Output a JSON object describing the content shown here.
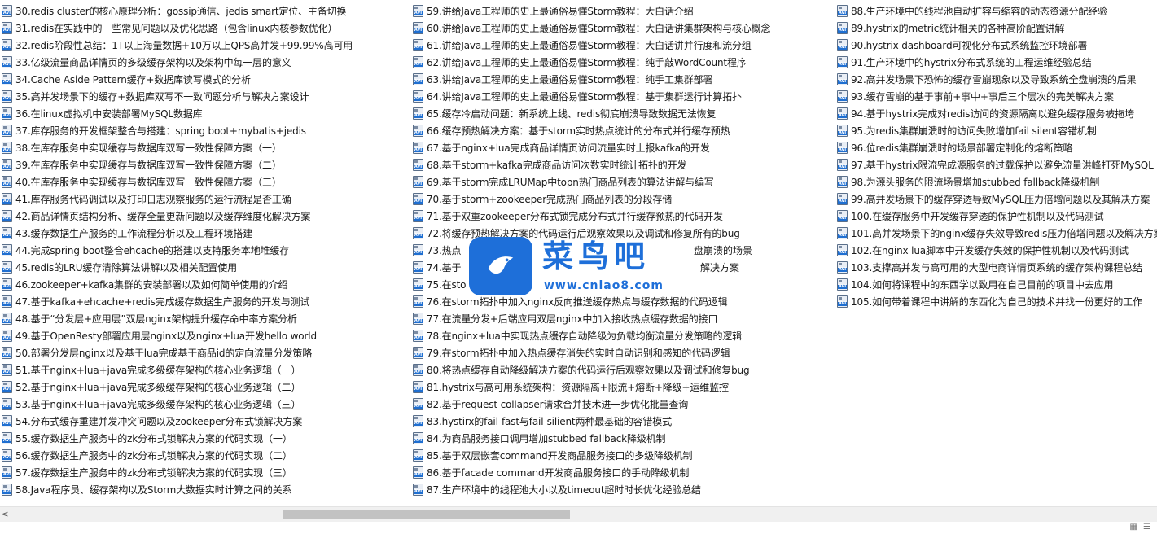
{
  "files": {
    "column1": [
      "30.redis cluster的核心原理分析：gossip通信、jedis smart定位、主备切换",
      "31.redis在实践中的一些常见问题以及优化思路（包含linux内核参数优化）",
      "32.redis阶段性总结：1T以上海量数据+10万以上QPS高并发+99.99%高可用",
      "33.亿级流量商品详情页的多级缓存架构以及架构中每一层的意义",
      "34.Cache Aside Pattern缓存+数据库读写模式的分析",
      "35.高并发场景下的缓存+数据库双写不一致问题分析与解决方案设计",
      "36.在linux虚拟机中安装部署MySQL数据库",
      "37.库存服务的开发框架整合与搭建：spring boot+mybatis+jedis",
      "38.在库存服务中实现缓存与数据库双写一致性保障方案（一）",
      "39.在库存服务中实现缓存与数据库双写一致性保障方案（二）",
      "40.在库存服务中实现缓存与数据库双写一致性保障方案（三）",
      "41.库存服务代码调试以及打印日志观察服务的运行流程是否正确",
      "42.商品详情页结构分析、缓存全量更新问题以及缓存维度化解决方案",
      "43.缓存数据生产服务的工作流程分析以及工程环境搭建",
      "44.完成spring boot整合ehcache的搭建以支持服务本地堆缓存",
      "45.redis的LRU缓存清除算法讲解以及相关配置使用",
      "46.zookeeper+kafka集群的安装部署以及如何简单使用的介绍",
      "47.基于kafka+ehcache+redis完成缓存数据生产服务的开发与测试",
      "48.基于“分发层+应用层”双层nginx架构提升缓存命中率方案分析",
      "49.基于OpenResty部署应用层nginx以及nginx+lua开发hello world",
      "50.部署分发层nginx以及基于lua完成基于商品id的定向流量分发策略",
      "51.基于nginx+lua+java完成多级缓存架构的核心业务逻辑（一）",
      "52.基于nginx+lua+java完成多级缓存架构的核心业务逻辑（二）",
      "53.基于nginx+lua+java完成多级缓存架构的核心业务逻辑（三）",
      "54.分布式缓存重建并发冲突问题以及zookeeper分布式锁解决方案",
      "55.缓存数据生产服务中的zk分布式锁解决方案的代码实现（一）",
      "56.缓存数据生产服务中的zk分布式锁解决方案的代码实现（二）",
      "57.缓存数据生产服务中的zk分布式锁解决方案的代码实现（三）",
      "58.Java程序员、缓存架构以及Storm大数据实时计算之间的关系"
    ],
    "column2": [
      "59.讲给Java工程师的史上最通俗易懂Storm教程：大白话介绍",
      "60.讲给Java工程师的史上最通俗易懂Storm教程：大白话讲集群架构与核心概念",
      "61.讲给Java工程师的史上最通俗易懂Storm教程：大白话讲并行度和流分组",
      "62.讲给Java工程师的史上最通俗易懂Storm教程：纯手敲WordCount程序",
      "63.讲给Java工程师的史上最通俗易懂Storm教程：纯手工集群部署",
      "64.讲给Java工程师的史上最通俗易懂Storm教程：基于集群运行计算拓扑",
      "65.缓存冷启动问题：新系统上线、redis彻底崩溃导致数据无法恢复",
      "66.缓存预热解决方案：基于storm实时热点统计的分布式并行缓存预热",
      "67.基于nginx+lua完成商品详情页访问流量实时上报kafka的开发",
      "68.基于storm+kafka完成商品访问次数实时统计拓扑的开发",
      "69.基于storm完成LRUMap中topn热门商品列表的算法讲解与编写",
      "70.基于storm+zookeeper完成热门商品列表的分段存储",
      "71.基于双重zookeeper分布式锁完成分布式并行缓存预热的代码开发",
      "72.将缓存预热解决方案的代码运行后观察效果以及调试和修复所有的bug",
      "73.热点",
      "74.基于",
      "75.在sto",
      "76.在storm拓扑中加入nginx反向推送缓存热点与缓存数据的代码逻辑",
      "77.在流量分发+后端应用双层nginx中加入接收热点缓存数据的接口",
      "78.在nginx+lua中实现热点缓存自动降级为负载均衡流量分发策略的逻辑",
      "79.在storm拓扑中加入热点缓存消失的实时自动识别和感知的代码逻辑",
      "80.将热点缓存自动降级解决方案的代码运行后观察效果以及调试和修复bug",
      "81.hystrix与高可用系统架构：资源隔离+限流+熔断+降级+运维监控",
      "82.基于request collapser请求合并技术进一步优化批量查询",
      "83.hystirx的fail-fast与fail-silient两种最基础的容错模式",
      "84.为商品服务接口调用增加stubbed fallback降级机制",
      "85.基于双层嵌套command开发商品服务接口的多级降级机制",
      "86.基于facade command开发商品服务接口的手动降级机制",
      "87.生产环境中的线程池大小以及timeout超时时长优化经验总结"
    ],
    "column3": [
      "88.生产环境中的线程池自动扩容与缩容的动态资源分配经验",
      "89.hystrix的metric统计相关的各种高阶配置讲解",
      "90.hystrix dashboard可视化分布式系统监控环境部署",
      "91.生产环境中的hystrix分布式系统的工程运维经验总结",
      "92.高并发场景下恐怖的缓存雪崩现象以及导致系统全盘崩溃的后果",
      "93.缓存雪崩的基于事前+事中+事后三个层次的完美解决方案",
      "94.基于hystrix完成对redis访问的资源隔离以避免缓存服务被拖垮",
      "95.为redis集群崩溃时的访问失败增加fail silent容错机制",
      "96.位redis集群崩溃时的场景部署定制化的熔断策略",
      "97.基于hystrix限流完成源服务的过载保护以避免流量洪峰打死MySQL",
      "98.为源头服务的限流场景增加stubbed fallback降级机制",
      "99.高并发场景下的缓存穿透导致MySQL压力倍增问题以及其解决方案",
      "100.在缓存服务中开发缓存穿透的保护性机制以及代码测试",
      "101.高并发场景下的nginx缓存失效导致redis压力倍增问题以及解决方案",
      "102.在nginx lua脚本中开发缓存失效的保护性机制以及代码测试",
      "103.支撑高并发与高可用的大型电商详情页系统的缓存架构课程总结",
      "104.如何将课程中的东西学以致用在自己目前的项目中去应用",
      "105.如何带着课程中讲解的东西化为自己的技术并找一份更好的工作"
    ],
    "suffix_fragments": {
      "73": "盘崩溃的场景",
      "74": "解决方案"
    }
  },
  "icon": {
    "name": "avi-file-icon",
    "badge": "AVI"
  },
  "watermark": {
    "title": "菜鸟吧",
    "url": "www.cniao8.com",
    "brand_color": "#1e6fd9"
  },
  "scrollbar": {
    "left_arrow": "<"
  },
  "status": {
    "view_icons": "▦ ☰"
  }
}
